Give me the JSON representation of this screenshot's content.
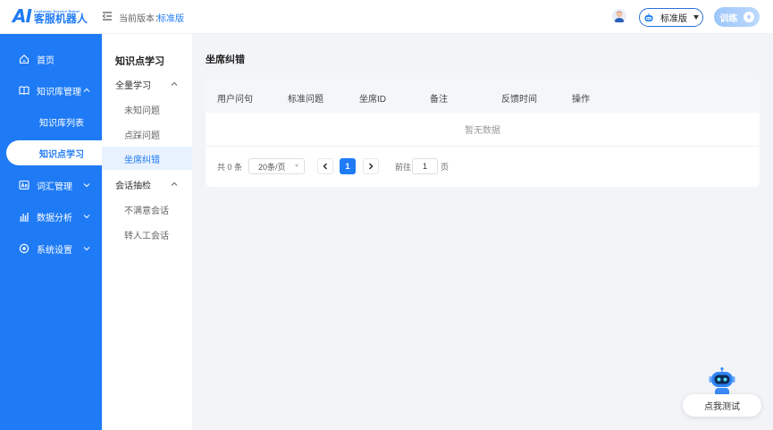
{
  "header": {
    "logo_ai": "AI",
    "logo_sub": "Customer Service Robot",
    "logo_main": "客服机器人",
    "version_label": "当前版本：",
    "version_value": "标准版",
    "edition_select": "标准版",
    "train_button": "训练"
  },
  "leftnav": {
    "items": [
      {
        "label": "首页",
        "icon": "home-icon"
      },
      {
        "label": "知识库管理",
        "icon": "book-icon",
        "caret": "up"
      },
      {
        "label": "知识库列表",
        "sub": true
      },
      {
        "label": "知识点学习",
        "sub": true,
        "active": true
      },
      {
        "label": "词汇管理",
        "icon": "vocab-icon",
        "caret": "down"
      },
      {
        "label": "数据分析",
        "icon": "chart-icon",
        "caret": "down"
      },
      {
        "label": "系统设置",
        "icon": "settings-icon",
        "caret": "down"
      }
    ]
  },
  "secnav": {
    "title": "知识点学习",
    "group1": "全量学习",
    "group1_items": [
      "未知问题",
      "点踩问题",
      "坐席纠错"
    ],
    "group2": "会话抽检",
    "group2_items": [
      "不满意会话",
      "转人工会话"
    ]
  },
  "main": {
    "title": "坐席纠错",
    "columns": [
      "用户问句",
      "标准问题",
      "坐席ID",
      "备注",
      "反馈时间",
      "操作"
    ],
    "empty_text": "暂无数据",
    "pager": {
      "total": "共 0 条",
      "page_size": "20条/页",
      "prev": "<",
      "current_page": "1",
      "next": ">",
      "goto_label": "前往",
      "goto_value": "1",
      "goto_unit": "页"
    }
  },
  "floating": {
    "test_button": "点我测试"
  },
  "colors": {
    "primary": "#1f7bf5",
    "sidebar": "#1f7bf5",
    "background": "#f2f4f8"
  }
}
